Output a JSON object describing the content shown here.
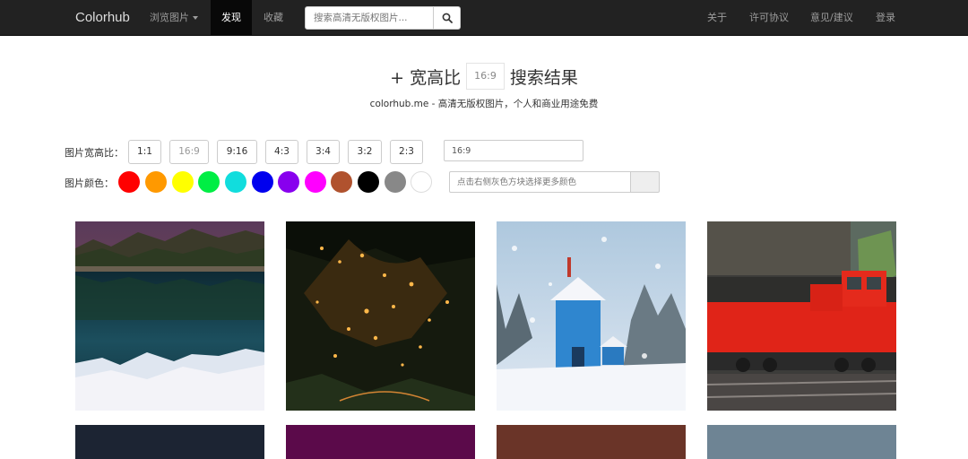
{
  "navbar": {
    "brand": "Colorhub",
    "browse": "浏览图片",
    "discover": "发现",
    "favorites": "收藏",
    "search_placeholder": "搜索高清无版权图片...",
    "about": "关于",
    "license": "许可协议",
    "feedback": "意见/建议",
    "login": "登录"
  },
  "heading": {
    "prefix": "+ 宽高比",
    "ratio": "16:9",
    "suffix": "搜索结果",
    "subtitle": "colorhub.me - 高清无版权图片，个人和商业用途免费"
  },
  "filters": {
    "ratio_label": "图片宽高比：",
    "ratios": [
      "1:1",
      "16:9",
      "9:16",
      "4:3",
      "3:4",
      "3:2",
      "2:3"
    ],
    "ratio_value": "16:9",
    "color_label": "图片颜色：",
    "colors": [
      "#ff0000",
      "#ff9900",
      "#ffff00",
      "#00ee44",
      "#11dddd",
      "#0000ee",
      "#8800ee",
      "#ff00ff",
      "#b0522e",
      "#000000",
      "#888888",
      "#ffffff"
    ],
    "color_placeholder": "点击右侧灰色方块选择更多颜色"
  },
  "photos": [
    {
      "subject": "mountain-lake-reflection"
    },
    {
      "subject": "night-village-lights"
    },
    {
      "subject": "blue-tower-house-snow"
    },
    {
      "subject": "red-locomotive"
    }
  ],
  "photo_row2_colors": [
    "#1c2433",
    "#5b0a4a",
    "#6a3428",
    "#6e8494"
  ]
}
